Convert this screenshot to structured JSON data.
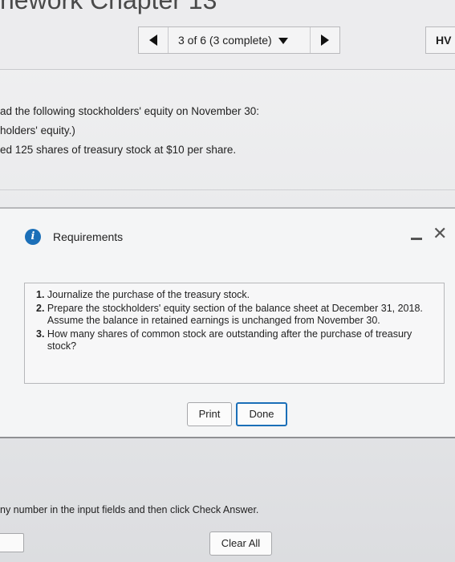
{
  "header": {
    "chapter_title": "nework Chapter 13",
    "nav_label": "3 of 6 (3 complete)",
    "hw_label": "HV"
  },
  "question": {
    "line1": "ad the following stockholders' equity on November 30:",
    "line2": "holders' equity.)",
    "line3": "ed 125 shares of treasury stock at $10 per share."
  },
  "modal": {
    "title": "Requirements",
    "requirements": [
      {
        "num": "1.",
        "text": "Journalize the purchase of the treasury stock."
      },
      {
        "num": "2.",
        "text": "Prepare the stockholders' equity section of the balance sheet at December 31, 2018. Assume the balance in retained earnings is unchanged from November 30."
      },
      {
        "num": "3.",
        "text": "How many shares of common stock are outstanding after the purchase of treasury stock?"
      }
    ],
    "print_label": "Print",
    "done_label": "Done"
  },
  "footer": {
    "instruction": "ny number in the input fields and then click Check Answer.",
    "clear_all_label": "Clear All"
  },
  "colors": {
    "accent": "#1b6fb8"
  }
}
